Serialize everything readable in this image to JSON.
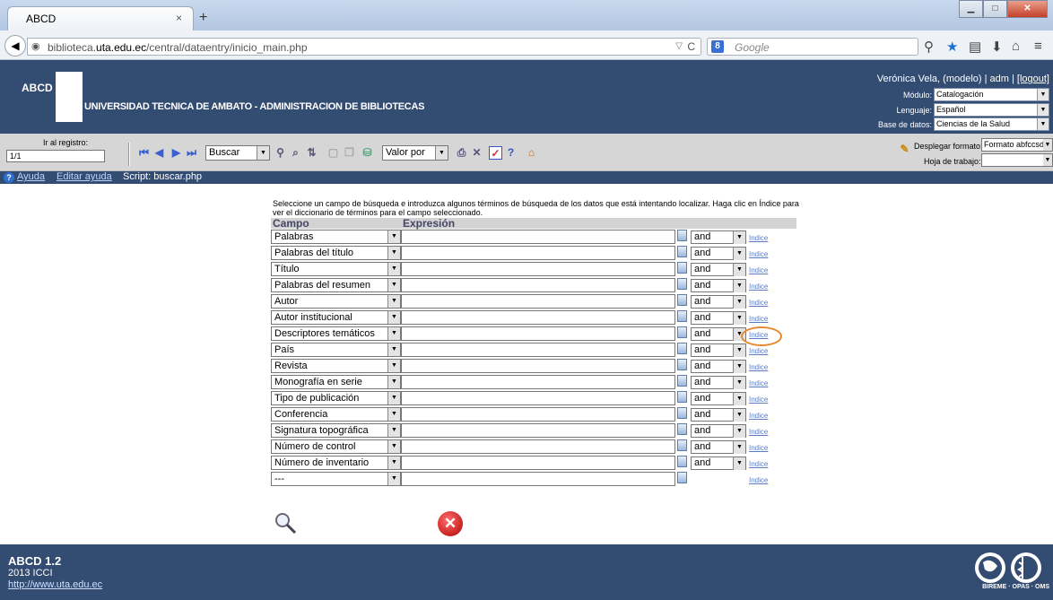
{
  "browser": {
    "tab_title": "ABCD",
    "tab_close": "×",
    "new_tab": "+",
    "url_prefix": "biblioteca.",
    "url_domain": "uta.edu.ec",
    "url_path": "/central/dataentry/inicio_main.php",
    "search_placeholder": "Google"
  },
  "header": {
    "logo_text": "ABCD",
    "title": "UNIVERSIDAD TECNICA DE AMBATO - ADMINISTRACION DE BIBLIOTECAS",
    "user": "Verónica Vela, (modelo) | adm | ",
    "logout": "[logout]",
    "modulo_label": "Módulo:",
    "modulo_value": "Catalogación",
    "lenguaje_label": "Lenguaje:",
    "lenguaje_value": "Español",
    "base_label": "Base de datos:",
    "base_value": "Ciencias de la Salud"
  },
  "toolbar": {
    "ir_label": "Ir al registro:",
    "ir_value": "1/1",
    "buscar_select": "Buscar",
    "valor_select": "Valor por",
    "desplegar_label": "Desplegar formato:",
    "desplegar_value": "Formato abfccsd",
    "hoja_label": "Hoja de trabajo:"
  },
  "helpbar": {
    "ayuda": "Ayuda",
    "editar": "Editar ayuda",
    "script": "Script: buscar.php"
  },
  "form": {
    "instructions": "Seleccione un campo de búsqueda e introduzca algunos términos de búsqueda de los datos que está intentando localizar. Haga clic en Índice para ver el diccionario de términos para el campo seleccionado.",
    "col_campo": "Campo",
    "col_expresion": "Expresión",
    "rows": [
      {
        "campo": "Palabras",
        "op": "and",
        "indice": "Indice"
      },
      {
        "campo": "Palabras del título",
        "op": "and",
        "indice": "Indice"
      },
      {
        "campo": "Título",
        "op": "and",
        "indice": "Indice"
      },
      {
        "campo": "Palabras del resumen",
        "op": "and",
        "indice": "Indice"
      },
      {
        "campo": "Autor",
        "op": "and",
        "indice": "Indice"
      },
      {
        "campo": "Autor institucional",
        "op": "and",
        "indice": "Indice"
      },
      {
        "campo": "Descriptores temáticos",
        "op": "and",
        "indice": "Indice"
      },
      {
        "campo": "País",
        "op": "and",
        "indice": "Indice"
      },
      {
        "campo": "Revista",
        "op": "and",
        "indice": "Indice"
      },
      {
        "campo": "Monografía en serie",
        "op": "and",
        "indice": "Indice"
      },
      {
        "campo": "Tipo de publicación",
        "op": "and",
        "indice": "Indice"
      },
      {
        "campo": "Conferencia",
        "op": "and",
        "indice": "Indice"
      },
      {
        "campo": "Signatura topográfica",
        "op": "and",
        "indice": "Indice"
      },
      {
        "campo": "Número de control",
        "op": "and",
        "indice": "Indice"
      },
      {
        "campo": "Número de inventario",
        "op": "and",
        "indice": "Indice"
      },
      {
        "campo": "---",
        "op": null,
        "indice": "Indice"
      }
    ]
  },
  "footer": {
    "version": "ABCD 1.2",
    "year": "2013 ICCI",
    "link": "http://www.uta.edu.ec",
    "logos_text": "BIREME · OPAS · OMS"
  }
}
